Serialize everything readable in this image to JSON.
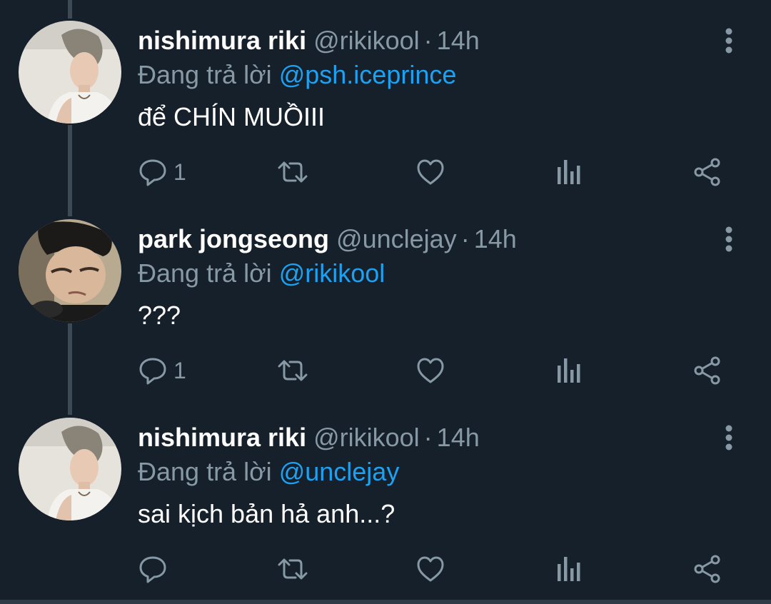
{
  "reply_prefix": "Đang trả lời",
  "colors": {
    "background": "#15202b",
    "accent": "#1da1f2",
    "muted": "#8899a6",
    "text": "#ffffff"
  },
  "tweets": [
    {
      "name": "nishimura riki",
      "handle": "@rikikool",
      "separator": "·",
      "time": "14h",
      "reply_to": "@psh.iceprince",
      "text": "để CHÍN MUỒIII",
      "reply_count": "1",
      "avatar_icon": "profile-photo"
    },
    {
      "name": "park jongseong",
      "handle": "@unclejay",
      "separator": "·",
      "time": "14h",
      "reply_to": "@rikikool",
      "text": "???",
      "reply_count": "1",
      "avatar_icon": "profile-photo"
    },
    {
      "name": "nishimura riki",
      "handle": "@rikikool",
      "separator": "·",
      "time": "14h",
      "reply_to": "@unclejay",
      "text": "sai kịch bản hả anh...?",
      "reply_count": "",
      "avatar_icon": "profile-photo"
    }
  ],
  "icons": [
    "reply-icon",
    "retweet-icon",
    "like-icon",
    "analytics-icon",
    "share-icon",
    "more-options-icon"
  ]
}
